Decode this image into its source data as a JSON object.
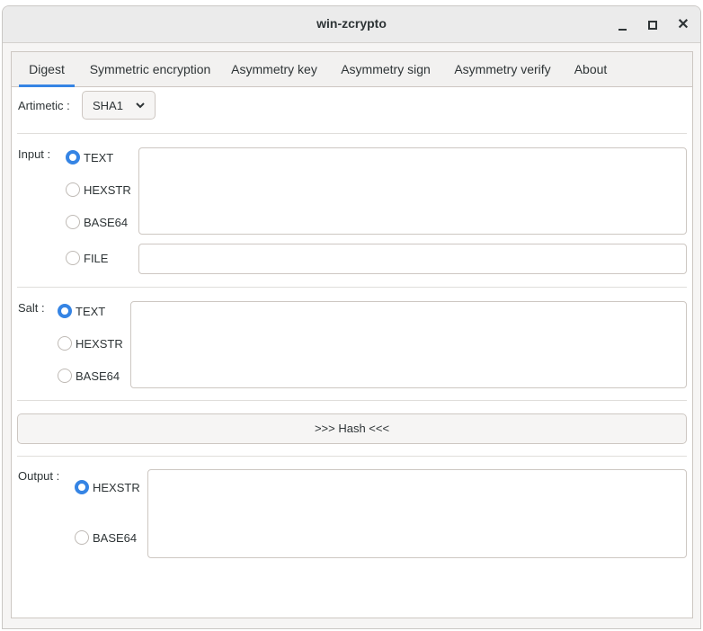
{
  "window": {
    "title": "win-zcrypto"
  },
  "tabs": [
    {
      "label": "Digest",
      "active": true
    },
    {
      "label": "Symmetric encryption",
      "active": false
    },
    {
      "label": "Asymmetry key",
      "active": false
    },
    {
      "label": "Asymmetry sign",
      "active": false
    },
    {
      "label": "Asymmetry verify",
      "active": false
    },
    {
      "label": "About",
      "active": false
    }
  ],
  "algorithm": {
    "label": "Artimetic :",
    "selected": "SHA1"
  },
  "input": {
    "label": "Input :",
    "options": [
      "TEXT",
      "HEXSTR",
      "BASE64",
      "FILE"
    ],
    "selected": "TEXT",
    "text_value": "",
    "file_value": ""
  },
  "salt": {
    "label": "Salt :",
    "options": [
      "TEXT",
      "HEXSTR",
      "BASE64"
    ],
    "selected": "TEXT",
    "value": ""
  },
  "hash_button": {
    "label": ">>> Hash <<<"
  },
  "output": {
    "label": "Output :",
    "options": [
      "HEXSTR",
      "BASE64"
    ],
    "selected": "HEXSTR",
    "value": ""
  },
  "colors": {
    "accent": "#3584e4",
    "border": "#cdc7c2",
    "text": "#2e3436"
  }
}
